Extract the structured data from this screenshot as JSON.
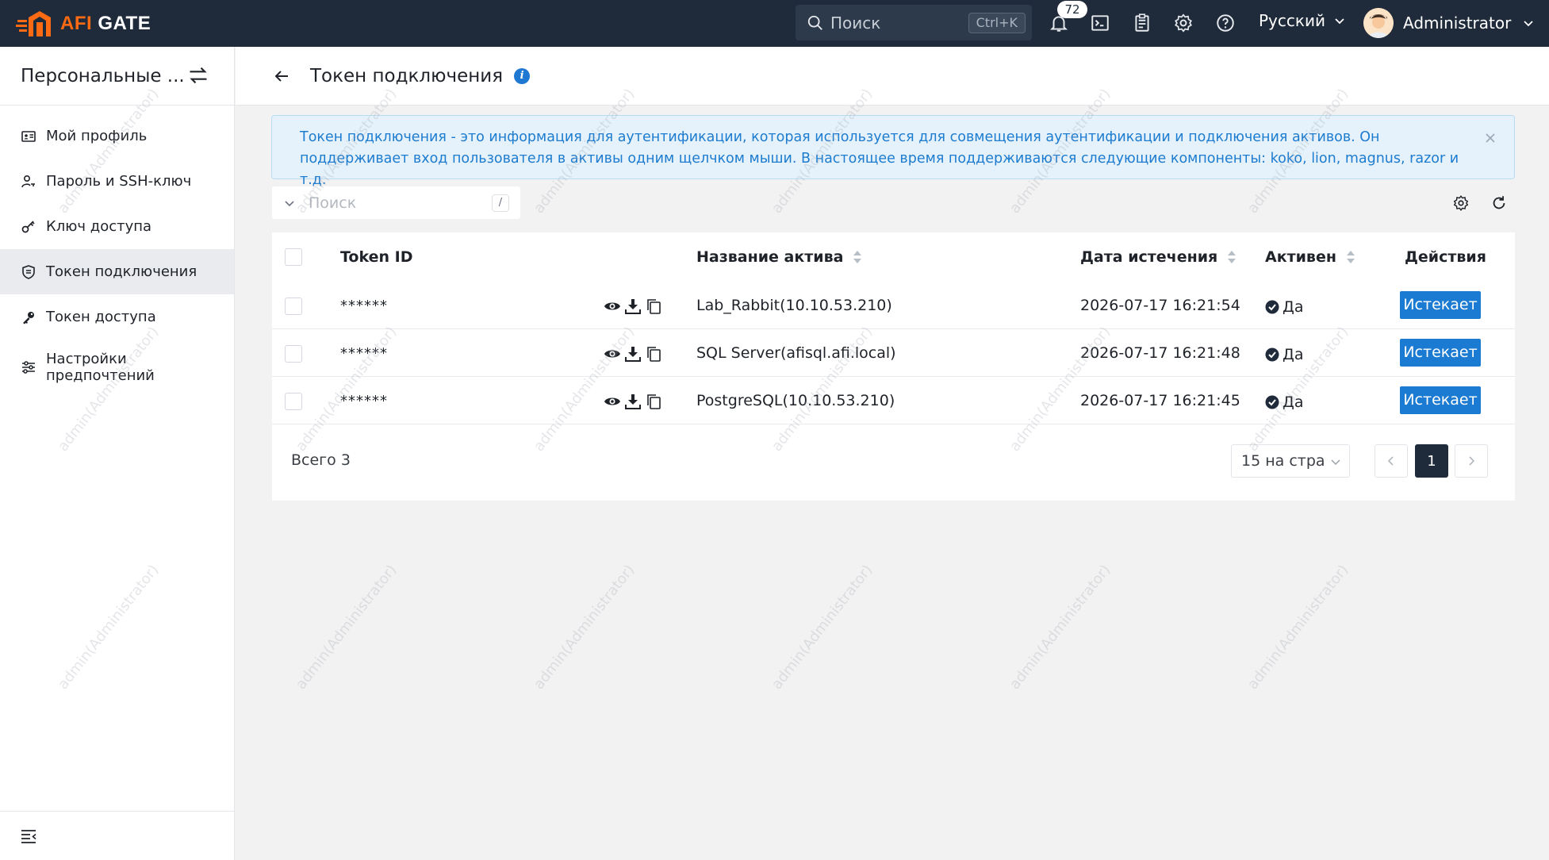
{
  "topbar": {
    "logo_primary": "AFI",
    "logo_secondary": " GATE",
    "search_placeholder": "Поиск",
    "search_shortcut": "Ctrl+K",
    "notification_count": "72",
    "language": "Русский",
    "username": "Administrator"
  },
  "sidebar": {
    "title": "Персональные ...",
    "items": [
      {
        "label": "Мой профиль",
        "icon": "profile-card-icon",
        "active": false
      },
      {
        "label": "Пароль и SSH-ключ",
        "icon": "user-key-icon",
        "active": false
      },
      {
        "label": "Ключ доступа",
        "icon": "key-icon",
        "active": false
      },
      {
        "label": "Токен подключения",
        "icon": "shield-icon",
        "active": true
      },
      {
        "label": "Токен доступа",
        "icon": "wrench-key-icon",
        "active": false
      },
      {
        "label": "Настройки\nпредпочтений",
        "icon": "sliders-icon",
        "active": false
      }
    ]
  },
  "page": {
    "title": "Токен подключения",
    "alert_text": "Токен подключения - это информация для аутентификации, которая используется для совмещения аутентификации и подключения активов. Он поддерживает вход пользователя в активы одним щелчком мыши. В настоящее время поддерживаются следующие компоненты: koko, lion, magnus, razor и т.д.",
    "search_placeholder": "Поиск",
    "search_shortcut": "/"
  },
  "table": {
    "columns": {
      "token_id": "Token ID",
      "asset_name": "Название актива",
      "expiry": "Дата истечения",
      "active": "Активен",
      "actions": "Действия"
    },
    "rows": [
      {
        "token": "******",
        "asset": "Lab_Rabbit(10.10.53.210)",
        "expires": "2026-07-17 16:21:54",
        "active": "Да",
        "action": "Истекает"
      },
      {
        "token": "******",
        "asset": "SQL Server(afisql.afi.local)",
        "expires": "2026-07-17 16:21:48",
        "active": "Да",
        "action": "Истекает"
      },
      {
        "token": "******",
        "asset": "PostgreSQL(10.10.53.210)",
        "expires": "2026-07-17 16:21:45",
        "active": "Да",
        "action": "Истекает"
      }
    ],
    "total": "Всего 3",
    "page_size": "15 на стра",
    "current_page": "1"
  },
  "watermark": "admin(Administrator)",
  "colors": {
    "topbar": "#1f2b3a",
    "brand_orange": "#ff6a13",
    "primary": "#1b7ad1",
    "alert_bg": "#e5f2fb"
  }
}
